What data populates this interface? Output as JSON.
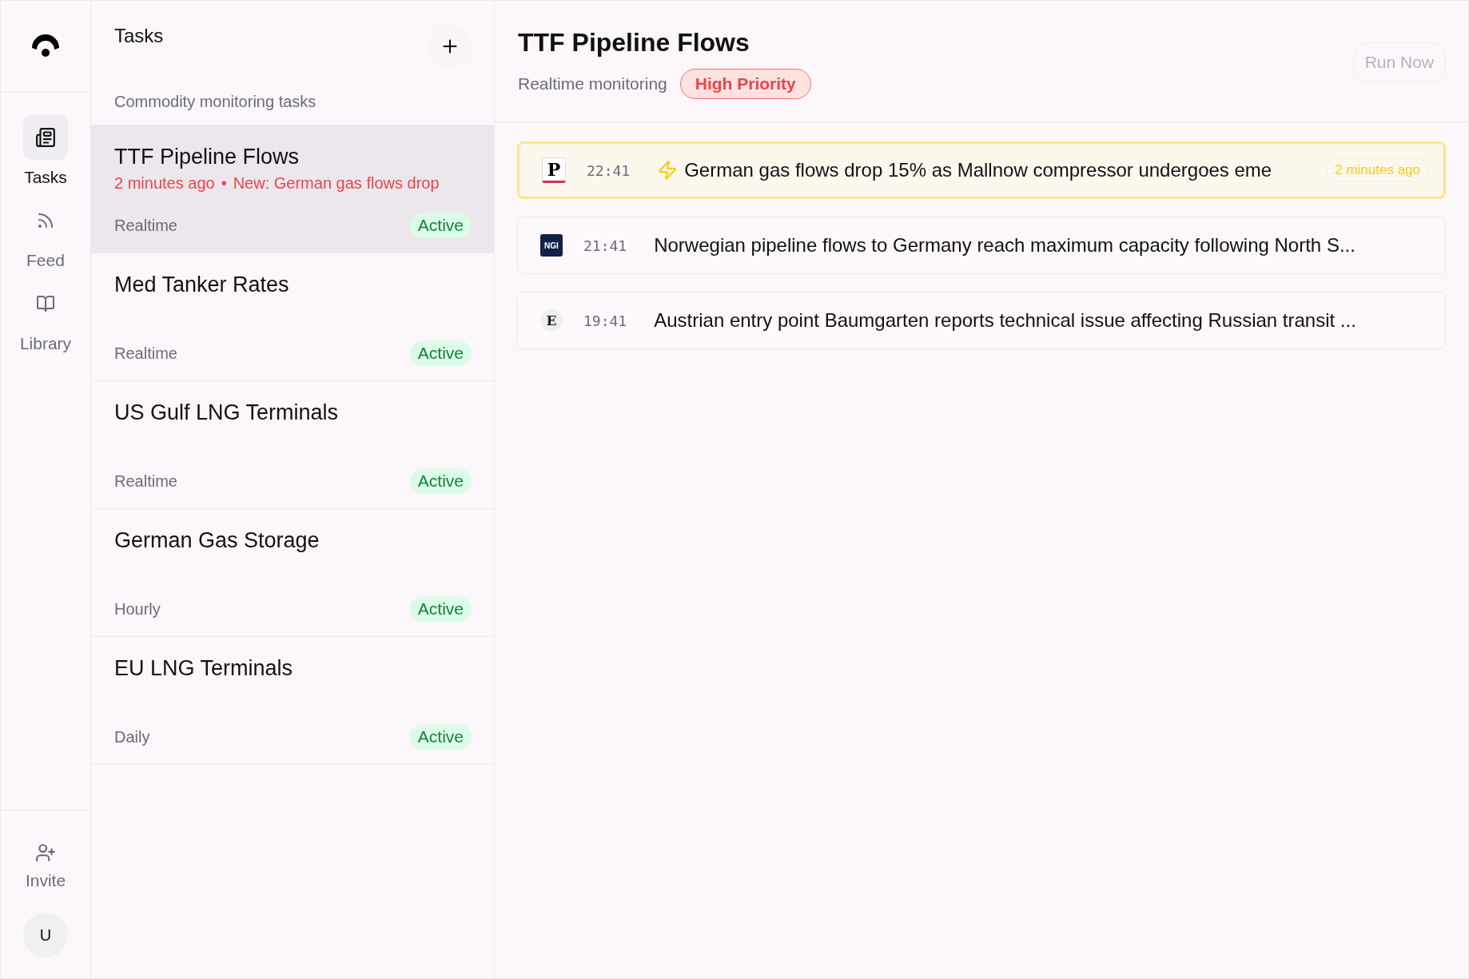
{
  "nav": {
    "items": [
      {
        "label": "Tasks",
        "kind": "tasks",
        "selected": true
      },
      {
        "label": "Feed",
        "kind": "feed",
        "selected": false
      },
      {
        "label": "Library",
        "kind": "library",
        "selected": false
      }
    ],
    "invite": "Invite",
    "avatar": "U"
  },
  "task_list": {
    "title": "Tasks",
    "subtitle": "Commodity monitoring tasks",
    "tasks": [
      {
        "name": "TTF Pipeline Flows",
        "alert_time": "2 minutes ago",
        "separator": "•",
        "alert_text": "New: German gas flows drop",
        "frequency": "Realtime",
        "status": "Active",
        "selected": true
      },
      {
        "name": "Med Tanker Rates",
        "frequency": "Realtime",
        "status": "Active",
        "selected": false
      },
      {
        "name": "US Gulf LNG Terminals",
        "frequency": "Realtime",
        "status": "Active",
        "selected": false
      },
      {
        "name": "German Gas Storage",
        "frequency": "Hourly",
        "status": "Active",
        "selected": false
      },
      {
        "name": "EU LNG Terminals",
        "frequency": "Daily",
        "status": "Active",
        "selected": false
      }
    ]
  },
  "detail": {
    "title": "TTF Pipeline Flows",
    "mode": "Realtime monitoring",
    "priority": "High Priority",
    "run_button": "Run Now",
    "run_disabled": true,
    "feed": [
      {
        "source": "P",
        "kind": "serif-dark",
        "time": "22:41",
        "breaking": true,
        "headline": "German gas flows drop 15% as Mallnow compressor undergoes eme",
        "badge": "2 minutes ago"
      },
      {
        "source": "NGI",
        "kind": "navy",
        "time": "21:41",
        "breaking": false,
        "headline": "Norwegian pipeline flows to Germany reach maximum capacity following North S..."
      },
      {
        "source": "E",
        "kind": "serif-light",
        "time": "19:41",
        "breaking": false,
        "headline": "Austrian entry point Baumgarten reports technical issue affecting Russian transit ..."
      }
    ]
  }
}
